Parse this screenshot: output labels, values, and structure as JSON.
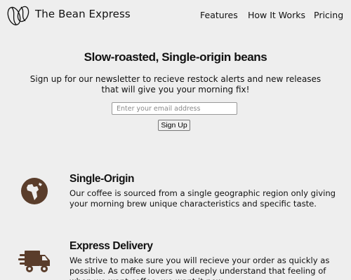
{
  "header": {
    "brand": "The Bean Express",
    "nav": {
      "features": "Features",
      "how_it_works": "How It Works",
      "pricing": "Pricing"
    }
  },
  "hero": {
    "title": "Slow-roasted, Single-origin beans",
    "text": "Sign up for our newsletter to recieve restock alerts and new releases that will give you your morning fix!",
    "email_placeholder": "Enter your email address",
    "signup_label": "Sign Up"
  },
  "features": [
    {
      "icon": "globe-africa-icon",
      "title": "Single-Origin",
      "text": "Our coffee is sourced from a single geographic region only giving your morning brew unique characteristics and specific taste."
    },
    {
      "icon": "shipping-fast-icon",
      "title": "Express Delivery",
      "text": "We strive to make sure you will recieve your order as quickly as possible. As coffee lovers we deeply understand that feeling of when we want coffee, we want it now."
    }
  ],
  "colors": {
    "background": "#eeeeee",
    "icon_brown": "#5a3d2b",
    "text": "#111111"
  }
}
